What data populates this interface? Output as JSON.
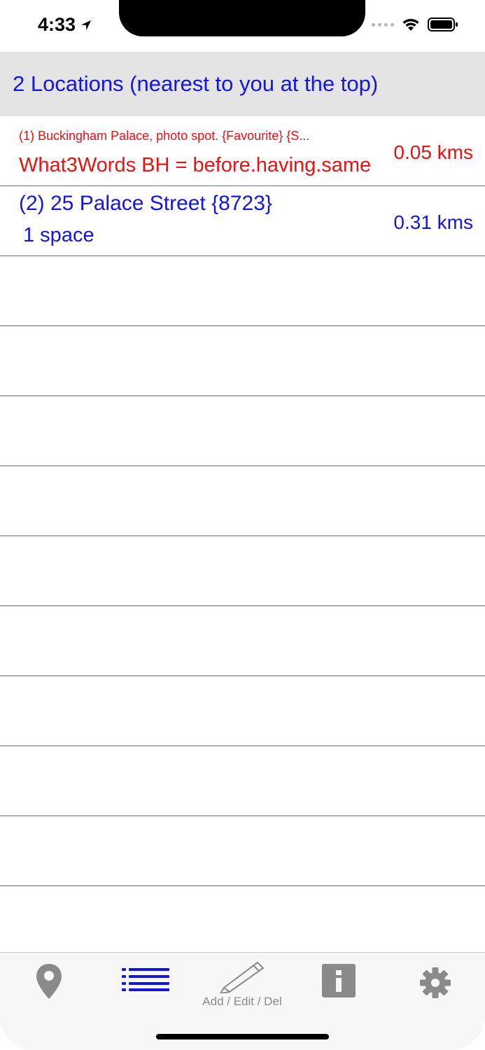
{
  "status_bar": {
    "time": "4:33"
  },
  "header": {
    "title": "2 Locations (nearest to you at the top)"
  },
  "locations": [
    {
      "title": "(1) Buckingham Palace, photo spot. {Favourite} {S...",
      "subtitle": "What3Words BH = before.having.same",
      "distance": "0.05 kms",
      "color": "#ee1111"
    },
    {
      "title": "(2) 25 Palace Street {8723}",
      "subtitle": "1 space",
      "distance": "0.31 kms",
      "color": "#1515e0"
    }
  ],
  "tab_bar": {
    "tabs": [
      {
        "icon": "map-pin-icon",
        "label": "",
        "selected": false
      },
      {
        "icon": "list-icon",
        "label": "",
        "selected": true
      },
      {
        "icon": "pencil-icon",
        "label": "Add / Edit / Del",
        "selected": false
      },
      {
        "icon": "info-icon",
        "label": "",
        "selected": false
      },
      {
        "icon": "gear-icon",
        "label": "",
        "selected": false
      }
    ]
  },
  "colors": {
    "accent_blue": "#1515e0",
    "favourite_red": "#ee1111",
    "header_bg": "#e4e4e4",
    "inactive_icon": "#8a8a8a"
  }
}
